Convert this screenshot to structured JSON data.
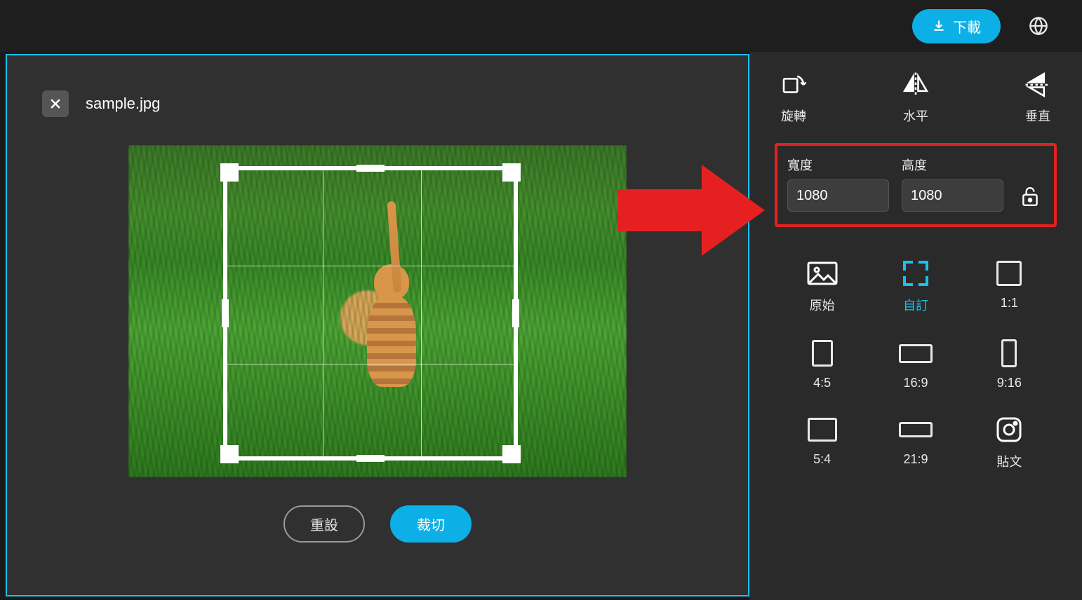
{
  "header": {
    "download_label": "下載"
  },
  "editor": {
    "filename": "sample.jpg",
    "reset_label": "重設",
    "crop_label": "裁切"
  },
  "tools": {
    "rotate_label": "旋轉",
    "flip_h_label": "水平",
    "flip_v_label": "垂直"
  },
  "dimensions": {
    "width_label": "寬度",
    "height_label": "高度",
    "width_value": "1080",
    "height_value": "1080"
  },
  "ratios": {
    "original": "原始",
    "custom": "自訂",
    "one_one": "1:1",
    "four_five": "4:5",
    "sixteen_nine": "16:9",
    "nine_sixteen": "9:16",
    "five_four": "5:4",
    "twentyone_nine": "21:9",
    "post": "貼文"
  },
  "colors": {
    "accent": "#0db0e6",
    "highlight": "#e62020"
  }
}
